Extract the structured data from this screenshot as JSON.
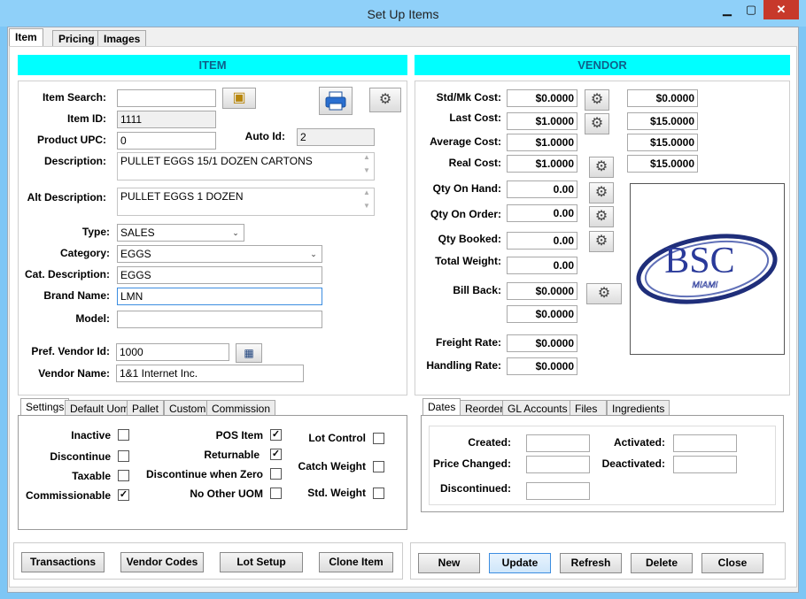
{
  "window": {
    "title": "Set Up Items",
    "minimize": "▁",
    "maximize": "▢",
    "close": "✕"
  },
  "main_tabs": [
    {
      "label": "Item"
    },
    {
      "label": "Pricing"
    },
    {
      "label": "Images"
    }
  ],
  "item": {
    "header": "ITEM",
    "search_label": "Item  Search:",
    "search_value": "",
    "id_label": "Item  ID:",
    "id_value": "1111",
    "upc_label": "Product  UPC:",
    "upc_value": "0",
    "auto_id_label": "Auto Id:",
    "auto_id_value": "2",
    "description_label": "Description:",
    "description_value": "PULLET EGGS 15/1 DOZEN CARTONS",
    "alt_description_label": "Alt Description:",
    "alt_description_value": "PULLET EGGS 1 DOZEN",
    "type_label": "Type:",
    "type_value": "SALES",
    "category_label": "Category:",
    "category_value": "EGGS",
    "cat_description_label": "Cat.  Description:",
    "cat_description_value": "EGGS",
    "brand_label": "Brand Name:",
    "brand_value": "LMN",
    "model_label": "Model:",
    "model_value": "",
    "pref_vendor_label": "Pref.  Vendor  Id:",
    "pref_vendor_value": "1000",
    "vendor_name_label": "Vendor Name:",
    "vendor_name_value": "1&1 Internet Inc."
  },
  "vendor": {
    "header": "VENDOR",
    "rows": [
      {
        "label": "Std/Mk Cost:",
        "value": "$0.0000",
        "extra": "$0.0000"
      },
      {
        "label": "Last  Cost:",
        "value": "$1.0000",
        "extra": "$15.0000"
      },
      {
        "label": "Average Cost:",
        "value": "$1.0000",
        "extra": "$15.0000"
      },
      {
        "label": "Real  Cost:",
        "value": "$1.0000",
        "extra": "$15.0000"
      },
      {
        "label": "Qty On Hand:",
        "value": "0.00"
      },
      {
        "label": "Qty On Order:",
        "value": "0.00"
      },
      {
        "label": "Qty Booked:",
        "value": "0.00"
      },
      {
        "label": "Total Weight:",
        "value": "0.00"
      },
      {
        "label": "Bill Back:",
        "value": "$0.0000",
        "value2": "$0.0000"
      },
      {
        "label": "Freight Rate:",
        "value": "$0.0000"
      },
      {
        "label": "Handling Rate:",
        "value": "$0.0000"
      }
    ],
    "logo_text": "BSC",
    "logo_sub": "MIAMI"
  },
  "settings_tabs": [
    {
      "label": "Settings"
    },
    {
      "label": "Default Uom"
    },
    {
      "label": "Pallet"
    },
    {
      "label": "Custom"
    },
    {
      "label": "Commission"
    }
  ],
  "settings": {
    "inactive": {
      "label": "Inactive",
      "checked": false
    },
    "discontinue": {
      "label": "Discontinue",
      "checked": false
    },
    "taxable": {
      "label": "Taxable",
      "checked": false
    },
    "commissionable": {
      "label": "Commissionable",
      "checked": true
    },
    "pos_item": {
      "label": "POS Item",
      "checked": true
    },
    "returnable": {
      "label": "Returnable",
      "checked": true
    },
    "discontinue_zero": {
      "label": "Discontinue when Zero",
      "checked": false
    },
    "no_other_uom": {
      "label": "No Other UOM",
      "checked": false
    },
    "lot_control": {
      "label": "Lot Control",
      "checked": false
    },
    "catch_weight": {
      "label": "Catch Weight",
      "checked": false
    },
    "std_weight": {
      "label": "Std. Weight",
      "checked": false
    }
  },
  "date_tabs": [
    {
      "label": "Dates"
    },
    {
      "label": "Reorder"
    },
    {
      "label": "GL Accounts"
    },
    {
      "label": "Files"
    },
    {
      "label": "Ingredients"
    }
  ],
  "dates": {
    "created_label": "Created:",
    "created_value": "",
    "price_changed_label": "Price Changed:",
    "price_changed_value": "",
    "discontinued_label": "Discontinued:",
    "discontinued_value": "",
    "activated_label": "Activated:",
    "activated_value": "",
    "deactivated_label": "Deactivated:",
    "deactivated_value": ""
  },
  "bottom_left_buttons": {
    "transactions": "Transactions",
    "vendor_codes": "Vendor Codes",
    "lot_setup": "Lot Setup",
    "clone_item": "Clone Item"
  },
  "bottom_right_buttons": {
    "new": "New",
    "update": "Update",
    "refresh": "Refresh",
    "delete": "Delete",
    "close": "Close"
  },
  "icons": {
    "gear": "⚙",
    "check": "✓",
    "chevron": "⌄",
    "up": "▲",
    "down": "▼"
  },
  "colors": {
    "header_bg": "#00ffff",
    "header_text": "#0f5f8a",
    "title_bar": "#8fd0f9",
    "close_red": "#c7392b"
  }
}
